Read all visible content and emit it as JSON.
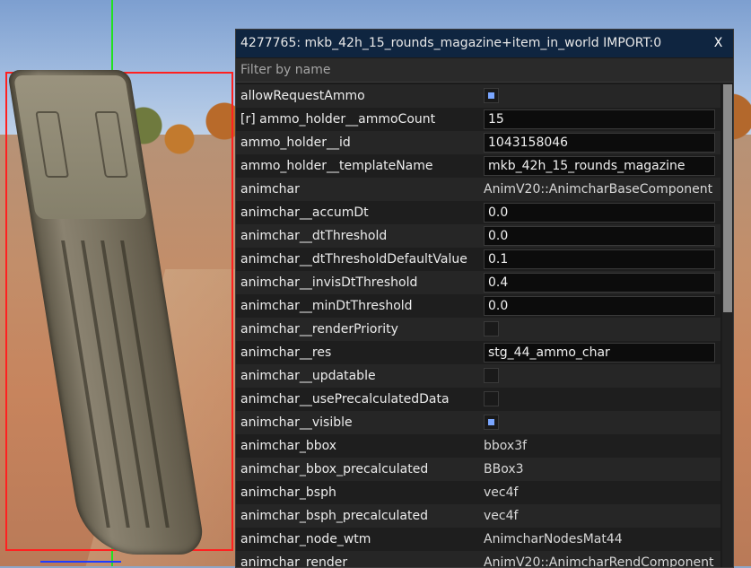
{
  "window": {
    "title": "4277765: mkb_42h_15_rounds_magazine+item_in_world  IMPORT:0",
    "close_label": "X"
  },
  "filter": {
    "placeholder": "Filter by name",
    "value": ""
  },
  "rows": [
    {
      "label": "allowRequestAmmo",
      "kind": "checkbox",
      "checked": true
    },
    {
      "label": "[r] ammo_holder__ammoCount",
      "kind": "input",
      "value": "15"
    },
    {
      "label": "ammo_holder__id",
      "kind": "input",
      "value": "1043158046"
    },
    {
      "label": "ammo_holder__templateName",
      "kind": "input",
      "value": "mkb_42h_15_rounds_magazine"
    },
    {
      "label": "animchar",
      "kind": "text",
      "value": "AnimV20::AnimcharBaseComponent"
    },
    {
      "label": "animchar__accumDt",
      "kind": "input",
      "value": "0.0"
    },
    {
      "label": "animchar__dtThreshold",
      "kind": "input",
      "value": "0.0"
    },
    {
      "label": "animchar__dtThresholdDefaultValue",
      "kind": "input",
      "value": "0.1"
    },
    {
      "label": "animchar__invisDtThreshold",
      "kind": "input",
      "value": "0.4"
    },
    {
      "label": "animchar__minDtThreshold",
      "kind": "input",
      "value": "0.0"
    },
    {
      "label": "animchar__renderPriority",
      "kind": "checkbox",
      "checked": false
    },
    {
      "label": "animchar__res",
      "kind": "input",
      "value": "stg_44_ammo_char"
    },
    {
      "label": "animchar__updatable",
      "kind": "checkbox",
      "checked": false
    },
    {
      "label": "animchar__usePrecalculatedData",
      "kind": "checkbox",
      "checked": false
    },
    {
      "label": "animchar__visible",
      "kind": "checkbox",
      "checked": true
    },
    {
      "label": "animchar_bbox",
      "kind": "text",
      "value": "bbox3f"
    },
    {
      "label": "animchar_bbox_precalculated",
      "kind": "text",
      "value": "BBox3"
    },
    {
      "label": "animchar_bsph",
      "kind": "text",
      "value": "vec4f"
    },
    {
      "label": "animchar_bsph_precalculated",
      "kind": "text",
      "value": "vec4f"
    },
    {
      "label": "animchar_node_wtm",
      "kind": "text",
      "value": "AnimcharNodesMat44"
    },
    {
      "label": "animchar_render",
      "kind": "text",
      "value": "AnimV20::AnimcharRendComponent"
    }
  ],
  "colors": {
    "title_bar": "#0f2540",
    "checkbox_accent": "#7aa6ff"
  }
}
